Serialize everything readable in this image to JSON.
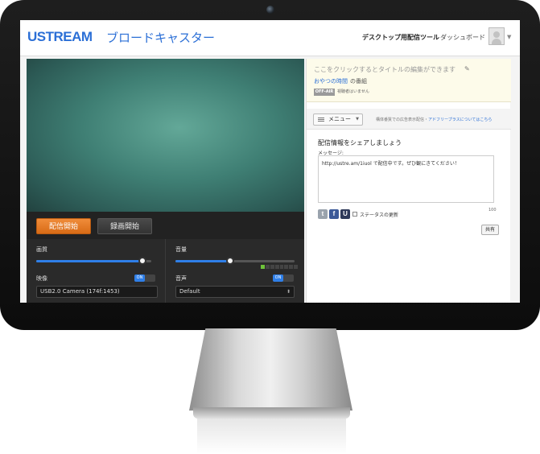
{
  "header": {
    "logo": "USTREAM",
    "logo_sub": "ブロードキャスター",
    "nav_tool": "デスクトップ用配信ツール",
    "nav_dashboard": "ダッシュボード"
  },
  "controls": {
    "broadcast_button": "配信開始",
    "record_button": "録画開始",
    "quality_label": "画質",
    "volume_label": "音量",
    "video_label": "映像",
    "audio_label": "音声",
    "video_toggle": "ON",
    "audio_toggle": "ON",
    "video_device": "USB2.0 Camera (174f:1453)",
    "audio_device": "Default",
    "quality_level": 0.92,
    "volume_level": 0.46
  },
  "channel": {
    "title_placeholder": "ここをクリックするとタイトルの編集ができます",
    "program_link": "おやつの時間",
    "program_suffix": "の番組",
    "status_badge": "OFF-AIR",
    "viewer_status": "視聴者はいません"
  },
  "menu": {
    "menu_button": "メニュー",
    "ad_text": "構体番質での広告表示配信・",
    "ad_link": "アドフリープラスについてはこちら"
  },
  "share": {
    "title": "配信情報をシェアしましょう",
    "message_label": "メッセージ:",
    "message_value": "http://ustre.am/1iuol で配信中です。ぜひ観にきてください！",
    "char_count": "100",
    "status_update_label": "ステータスの更新",
    "share_button": "共有"
  }
}
